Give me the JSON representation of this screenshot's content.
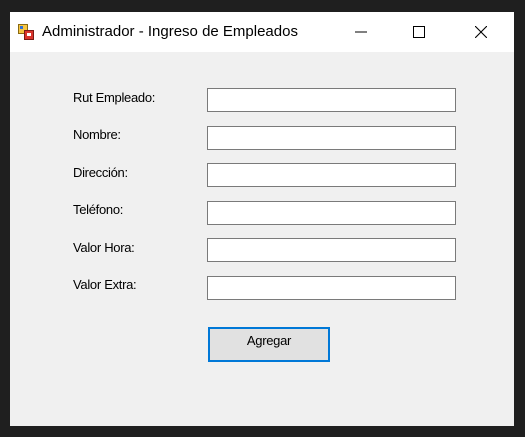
{
  "window": {
    "title": "Administrador - Ingreso de Empleados",
    "icon": "winforms-app-icon",
    "controls": {
      "minimize_icon": "minimize-icon",
      "maximize_icon": "maximize-icon",
      "close_icon": "close-icon"
    }
  },
  "form": {
    "fields": [
      {
        "label": "Rut Empleado:",
        "value": ""
      },
      {
        "label": "Nombre:",
        "value": ""
      },
      {
        "label": "Dirección:",
        "value": ""
      },
      {
        "label": "Teléfono:",
        "value": ""
      },
      {
        "label": "Valor Hora:",
        "value": ""
      },
      {
        "label": "Valor Extra:",
        "value": ""
      }
    ],
    "submit_label": "Agregar"
  },
  "colors": {
    "window_background": "#f0f0f0",
    "titlebar_background": "#ffffff",
    "button_focus_border": "#0078d7",
    "input_border": "#7a7a7a"
  }
}
